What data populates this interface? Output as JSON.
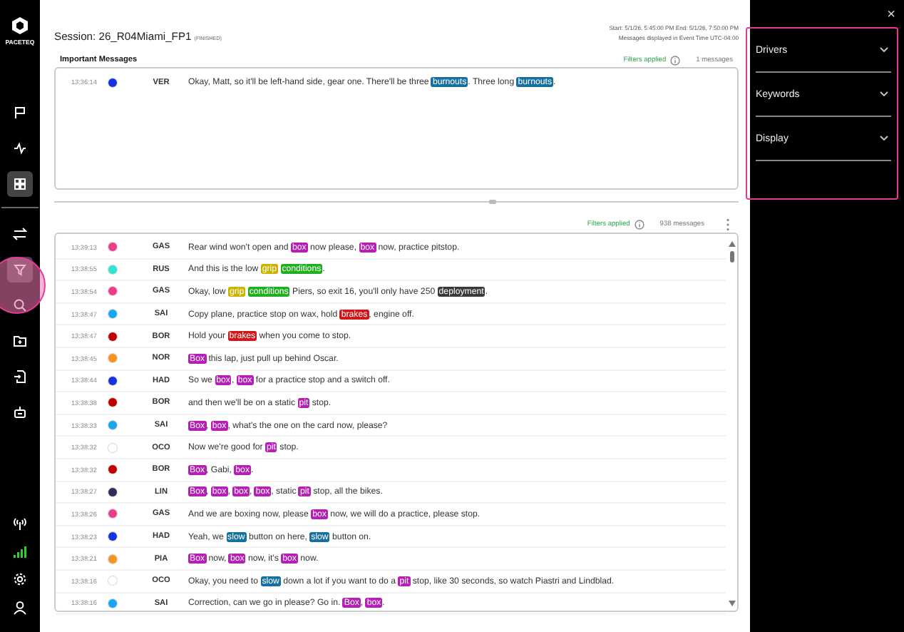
{
  "brand": "PACETEQ",
  "sidebar": {
    "items": [
      {
        "selected": false
      },
      {
        "selected": false
      },
      {
        "selected": true
      },
      {
        "selected": false
      },
      {
        "selected": true
      },
      {
        "selected": false
      },
      {
        "selected": false
      },
      {
        "selected": false
      },
      {
        "selected": false
      }
    ]
  },
  "session": {
    "title": "Session: 26_R04Miami_FP1",
    "status": "(FINISHED)",
    "range": "Start: 5/1/26, 5:45:00 PM    End: 5/1/26, 7:50:00 PM",
    "timezone": "Messages displayed in Event Time UTC-04:00"
  },
  "important": {
    "title": "Important Messages",
    "filters": "Filters applied",
    "count": "1 messages",
    "rows": [
      {
        "time": "13:36:14",
        "color": "#1432e0",
        "driver": "VER",
        "parts": [
          {
            "text": "Okay, Matt, so it'll be left-hand side, gear one. There'll be three "
          },
          {
            "text": "burnouts",
            "color": "#16709e"
          },
          {
            "text": ". Three long "
          },
          {
            "text": "burnouts",
            "color": "#16709e"
          },
          {
            "text": "."
          }
        ]
      }
    ]
  },
  "messages": {
    "filters": "Filters applied",
    "count": "938 messages",
    "rows": [
      {
        "time": "13:39:13",
        "color": "#ec3d8c",
        "driver": "GAS",
        "parts": [
          {
            "text": "Rear wind won't open and "
          },
          {
            "text": "box",
            "color": "#b41fb4"
          },
          {
            "text": " now please, "
          },
          {
            "text": "box",
            "color": "#b41fb4"
          },
          {
            "text": " now, practice pitstop."
          }
        ]
      },
      {
        "time": "13:38:55",
        "color": "#2ee6d6",
        "driver": "RUS",
        "parts": [
          {
            "text": "And this is the low "
          },
          {
            "text": "grip",
            "color": "#c9b200"
          },
          {
            "text": "conditions",
            "color": "#1faf1f"
          },
          {
            "text": "."
          }
        ]
      },
      {
        "time": "13:38:54",
        "color": "#ec3d8c",
        "driver": "GAS",
        "parts": [
          {
            "text": "Okay, low "
          },
          {
            "text": "grip",
            "color": "#c9b200"
          },
          {
            "text": "conditions",
            "color": "#1faf1f"
          },
          {
            "text": " Piers, so exit 16, you'll only have 250 "
          },
          {
            "text": "deployment",
            "color": "#3a3a3a"
          },
          {
            "text": "."
          }
        ]
      },
      {
        "time": "13:38:47",
        "color": "#18a6ee",
        "driver": "SAI",
        "parts": [
          {
            "text": "Copy plane, practice stop on wax, hold "
          },
          {
            "text": "brakes",
            "color": "#d01616"
          },
          {
            "text": ", engine off."
          }
        ]
      },
      {
        "time": "13:38:47",
        "color": "#c00000",
        "driver": "BOR",
        "parts": [
          {
            "text": "Hold your "
          },
          {
            "text": "brakes",
            "color": "#d01616"
          },
          {
            "text": " when you come to stop."
          }
        ]
      },
      {
        "time": "13:38:45",
        "color": "#f7941d",
        "driver": "NOR",
        "parts": [
          {
            "text": "Box",
            "color": "#b41fb4"
          },
          {
            "text": " this lap, just pull up behind Oscar."
          }
        ]
      },
      {
        "time": "13:38:44",
        "color": "#1432e0",
        "driver": "HAD",
        "parts": [
          {
            "text": "So we "
          },
          {
            "text": "box",
            "color": "#b41fb4"
          },
          {
            "text": ", "
          },
          {
            "text": "box",
            "color": "#b41fb4"
          },
          {
            "text": " for a practice stop and a switch off."
          }
        ]
      },
      {
        "time": "13:38:38",
        "color": "#c00000",
        "driver": "BOR",
        "parts": [
          {
            "text": "and then we'll be on a static "
          },
          {
            "text": "pit",
            "color": "#b41fb4"
          },
          {
            "text": " stop."
          }
        ]
      },
      {
        "time": "13:38:33",
        "color": "#18a6ee",
        "driver": "SAI",
        "parts": [
          {
            "text": "Box",
            "color": "#b41fb4"
          },
          {
            "text": ", "
          },
          {
            "text": "box",
            "color": "#b41fb4"
          },
          {
            "text": ", what's the one on the card now, please?"
          }
        ]
      },
      {
        "time": "13:38:32",
        "color": "#ffffff",
        "driver": "OCO",
        "parts": [
          {
            "text": "Now we're good for "
          },
          {
            "text": "pit",
            "color": "#b41fb4"
          },
          {
            "text": " stop."
          }
        ]
      },
      {
        "time": "13:38:32",
        "color": "#c00000",
        "driver": "BOR",
        "parts": [
          {
            "text": "Box",
            "color": "#b41fb4"
          },
          {
            "text": ", Gabi, "
          },
          {
            "text": "box",
            "color": "#b41fb4"
          },
          {
            "text": "."
          }
        ]
      },
      {
        "time": "13:38:27",
        "color": "#2e2e5c",
        "driver": "LIN",
        "parts": [
          {
            "text": "Box",
            "color": "#b41fb4"
          },
          {
            "text": ", "
          },
          {
            "text": "box",
            "color": "#b41fb4"
          },
          {
            "text": ", "
          },
          {
            "text": "box",
            "color": "#b41fb4"
          },
          {
            "text": ", "
          },
          {
            "text": "box",
            "color": "#b41fb4"
          },
          {
            "text": ", static "
          },
          {
            "text": "pit",
            "color": "#b41fb4"
          },
          {
            "text": " stop, all the bikes."
          }
        ]
      },
      {
        "time": "13:38:26",
        "color": "#ec3d8c",
        "driver": "GAS",
        "parts": [
          {
            "text": "And we are boxing now, please "
          },
          {
            "text": "box",
            "color": "#b41fb4"
          },
          {
            "text": " now, we will do a practice, please stop."
          }
        ]
      },
      {
        "time": "13:38:23",
        "color": "#1432e0",
        "driver": "HAD",
        "parts": [
          {
            "text": "Yeah, we "
          },
          {
            "text": "slow",
            "color": "#16709e"
          },
          {
            "text": " button on here, "
          },
          {
            "text": "slow",
            "color": "#16709e"
          },
          {
            "text": " button on."
          }
        ]
      },
      {
        "time": "13:38:21",
        "color": "#f7941d",
        "driver": "PIA",
        "parts": [
          {
            "text": "Box",
            "color": "#b41fb4"
          },
          {
            "text": " now, "
          },
          {
            "text": "box",
            "color": "#b41fb4"
          },
          {
            "text": " now, it's "
          },
          {
            "text": "box",
            "color": "#b41fb4"
          },
          {
            "text": " now."
          }
        ]
      },
      {
        "time": "13:38:16",
        "color": "#ffffff",
        "driver": "OCO",
        "parts": [
          {
            "text": "Okay, you need to "
          },
          {
            "text": "slow",
            "color": "#16709e"
          },
          {
            "text": " down a lot if you want to do a "
          },
          {
            "text": "pit",
            "color": "#b41fb4"
          },
          {
            "text": " stop, like 30 seconds, so watch Piastri and Lindblad."
          }
        ]
      },
      {
        "time": "13:38:16",
        "color": "#18a6ee",
        "driver": "SAI",
        "parts": [
          {
            "text": "Correction, can we go in please? Go in. "
          },
          {
            "text": "Box",
            "color": "#b41fb4"
          },
          {
            "text": ", "
          },
          {
            "text": "box",
            "color": "#b41fb4"
          },
          {
            "text": "."
          }
        ]
      }
    ]
  },
  "panel": {
    "close": "×",
    "sections": [
      {
        "label": "Drivers",
        "expanded": false
      },
      {
        "label": "Keywords",
        "expanded": false
      },
      {
        "label": "Display",
        "expanded": false
      }
    ]
  }
}
